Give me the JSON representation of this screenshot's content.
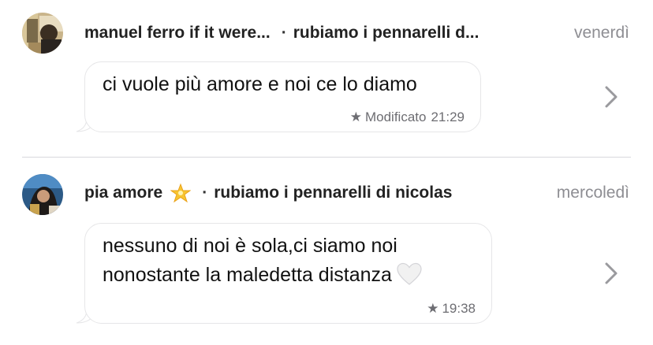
{
  "messages": [
    {
      "sender": "manuel ferro if it were...",
      "separator": "·",
      "chat": "rubiamo i pennarelli d...",
      "date": "venerdì",
      "text_lines": [
        "ci vuole più amore e noi ce lo diamo"
      ],
      "meta_star": "★",
      "meta_label": "Modificato",
      "time": "21:29"
    },
    {
      "sender": "pia amore",
      "separator": "·",
      "chat": "rubiamo i pennarelli di nicolas",
      "date": "mercoledì",
      "text_lines": [
        "nessuno di noi è sola,ci siamo noi",
        "nonostante la maledetta distanza"
      ],
      "meta_star": "★",
      "time": "19:38"
    }
  ],
  "icons": {
    "sender_emoji": "glowing-star-icon",
    "text_emoji": "white-heart-icon",
    "chevron": "chevron-right-icon"
  },
  "colors": {
    "date": "#8e8e93",
    "bubble_border": "#e6e6e8",
    "divider": "#d8d8dc",
    "chevron": "#9a9a9e"
  }
}
